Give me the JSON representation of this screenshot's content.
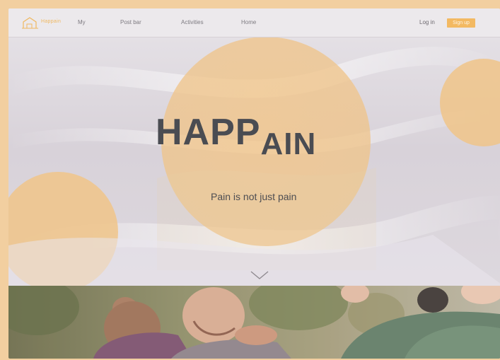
{
  "header": {
    "logo_text": "Happain",
    "nav": {
      "my": "My",
      "postbar": "Post bar",
      "activities": "Activities",
      "home": "Home"
    },
    "login_label": "Log in",
    "signup_label": "Sign up"
  },
  "hero": {
    "title_main": "HAPP",
    "title_sub": "AIN",
    "tagline": "Pain is not just pain"
  },
  "colors": {
    "accent": "#f3b962",
    "title": "#4a4c52",
    "background": "#f2cfa0"
  },
  "icons": {
    "scroll": "chevron-down-icon",
    "logo": "house-logo-icon"
  }
}
